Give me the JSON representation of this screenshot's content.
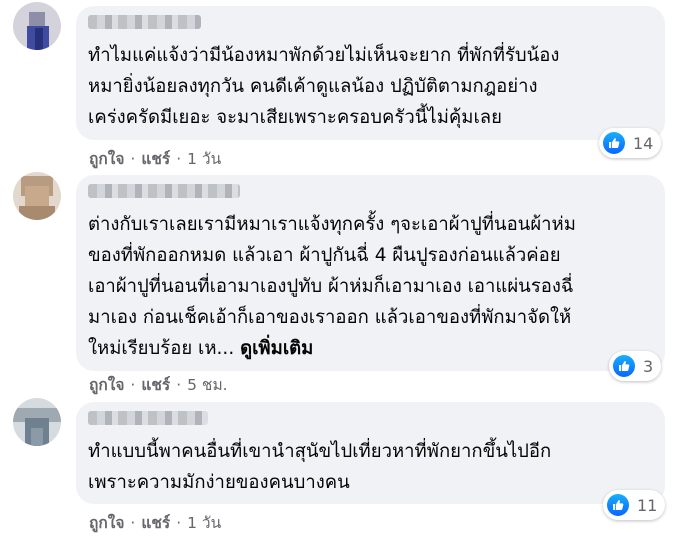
{
  "comments": [
    {
      "text_lines": [
        "ทำไมแค่แจ้งว่ามีน้องหมาพักด้วยไม่เห็นจะยาก ที่พักที่รับน้อง",
        "หมายิ่งน้อยลงทุกวัน คนดีเค้าดูแลน้อง ปฏิบัติตามกฎอย่าง",
        "เคร่งครัดมีเยอะ จะมาเสียเพราะครอบครัวนี้ไม่คุ้มเลย"
      ],
      "reaction_count": "14",
      "like_label": "ถูกใจ",
      "share_label": "แชร์",
      "separator": "·",
      "time": "1 วัน"
    },
    {
      "text_lines": [
        "ต่างกับเราเลยเรามีหมาเราแจ้งทุกครั้ง ๆจะเอาผ้าปูที่นอนผ้าห่ม",
        "ของที่พักออกหมด แล้วเอา ผ้าปูกันฉี่ 4 ผืนปูรองก่อนแล้วค่อย",
        "เอาผ้าปูที่นอนที่เอามาเองปูทับ ผ้าห่มก็เอามาเอง เอาแผ่นรองฉี่",
        "มาเอง ก่อนเช็คเอ้าก็เอาของเราออก แล้วเอาของที่พักมาจัดให้",
        "ใหม่เรียบร้อย เห..."
      ],
      "see_more": "ดูเพิ่มเติม",
      "reaction_count": "3",
      "like_label": "ถูกใจ",
      "share_label": "แชร์",
      "separator": "·",
      "time": "5 ชม."
    },
    {
      "text_lines": [
        "ทำแบบนี้พาคนอื่นที่เขานำสุนัขไปเที่ยวหาที่พักยากขึ้นไปอีก",
        "เพราะความมักง่ายของคนบางคน"
      ],
      "reaction_count": "11",
      "like_label": "ถูกใจ",
      "share_label": "แชร์",
      "separator": "·",
      "time": "1 วัน"
    }
  ],
  "colors": {
    "bubble": "#f0f2f5",
    "meta_text": "#65676b",
    "like_blue": "#0866ff"
  },
  "icons": {
    "reaction": "like-thumb-icon"
  }
}
